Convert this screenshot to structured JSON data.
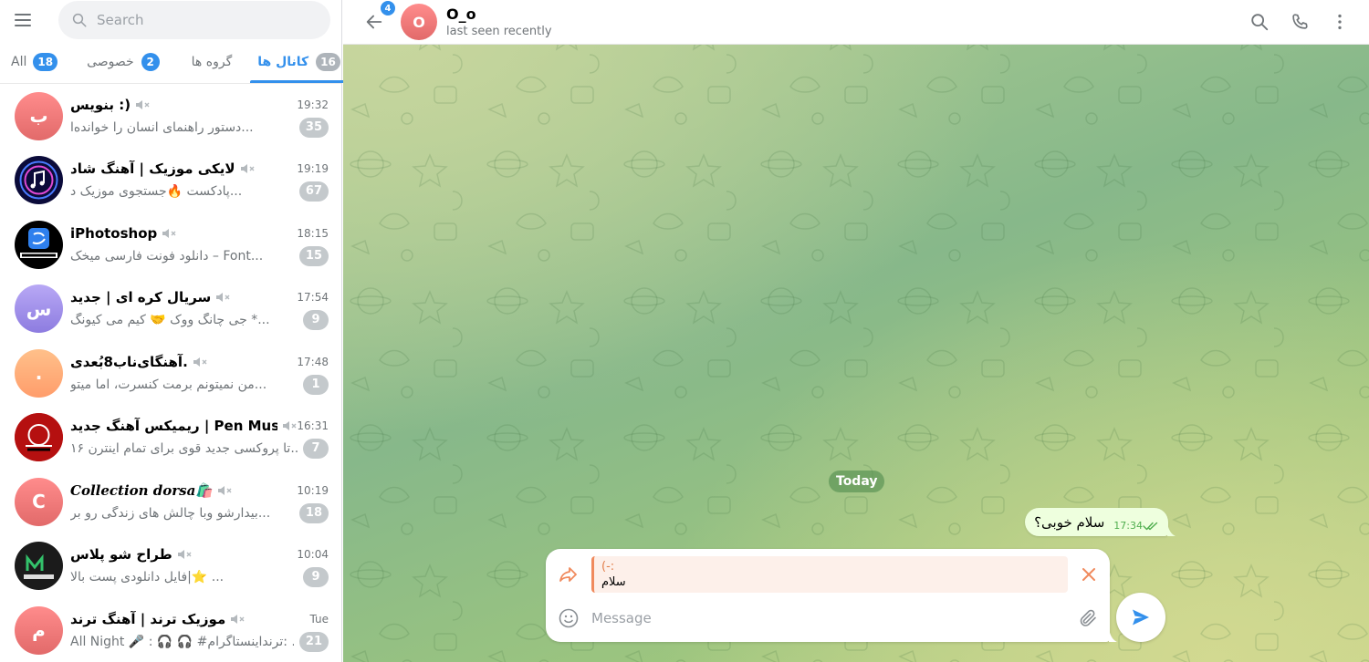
{
  "sidebar": {
    "search_placeholder": "Search",
    "folders": [
      {
        "label": "All",
        "badge": "18"
      },
      {
        "label": "خصوصی",
        "badge": "2"
      },
      {
        "label": "گروه ها",
        "badge": ""
      },
      {
        "label": "کانال ها",
        "badge": "16"
      }
    ],
    "active_folder": "کانال ها",
    "chats": [
      {
        "name": "بنویس :)",
        "time": "19:32",
        "preview": "دستور راهنمای انسان را خوانده‌ا...",
        "unread": "35",
        "avatar_letter": "ب",
        "avatar_color": "#f27c7c"
      },
      {
        "name": "لایکی موزیک | آهنگ شاد",
        "time": "19:19",
        "preview": "پادکست 🔥جستجوی موزیک د...",
        "unread": "67",
        "avatar_letter": "",
        "avatar_color": "#0b0b3a"
      },
      {
        "name": "iPhotoshop",
        "time": "18:15",
        "preview": "دانلود فونت فارسی میخک – Font...",
        "unread": "15",
        "avatar_letter": "",
        "avatar_color": "#000000"
      },
      {
        "name": "سریال کره ای | جدید",
        "time": "17:54",
        "preview": "جی چانگ ووک 🤝 کیم می کیونگ *...",
        "unread": "9",
        "avatar_letter": "س",
        "avatar_color": "#9a8ee8"
      },
      {
        "name": "آهنگای‌ناب8بُعدی.",
        "time": "17:48",
        "preview": "من نمیتونم برمت کنسرت، اما میتو...",
        "unread": "1",
        "avatar_letter": ".",
        "avatar_color": "#ffab7a"
      },
      {
        "name": "ریمیکس آهنگ جدید | Pen Musix",
        "time": "16:31",
        "preview": "۱۶ تا پروکسی جدید قوی برای تمام اینترن...",
        "unread": "7",
        "avatar_letter": "",
        "avatar_color": "#c51616"
      },
      {
        "name": "Collection dorsa🛍️",
        "time": "10:19",
        "preview": "بیدارشو وبا چالش های زندگی رو بر...",
        "unread": "18",
        "avatar_letter": "C",
        "avatar_color": "#f27c7c"
      },
      {
        "name": "طراح شو پلاس",
        "time": "10:04",
        "preview": "فایل دانلودی پست بالا|⭐ ...",
        "unread": "9",
        "avatar_letter": "",
        "avatar_color": "#1b1b1b"
      },
      {
        "name": "موزیک ترند | آهنگ ترند",
        "time": "Tue",
        "preview": "All Night 🎤 : 🎧 🎧 #ترنداینستاگرام: ...",
        "unread": "21",
        "avatar_letter": "م",
        "avatar_color": "#f27c7c"
      }
    ]
  },
  "header": {
    "back_badge": "4",
    "avatar_letter": "O",
    "name": "O_o",
    "status": "last seen recently"
  },
  "chat": {
    "date_chip": "Today",
    "messages": [
      {
        "text": "سلام خوبی؟",
        "time": "17:34",
        "outgoing": true,
        "read": true
      }
    ]
  },
  "composer": {
    "reply_title": ":-)",
    "reply_text": "سلام",
    "placeholder": "Message"
  },
  "colors": {
    "accent": "#3390ec",
    "outgoing_bubble": "#eeffde",
    "reply_accent": "#f08a5d"
  },
  "icons": [
    "menu-icon",
    "search-icon",
    "mute-icon",
    "back-arrow-icon",
    "phone-icon",
    "more-vertical-icon",
    "forward-icon",
    "close-icon",
    "emoji-icon",
    "paperclip-icon",
    "send-icon",
    "double-check-icon"
  ]
}
